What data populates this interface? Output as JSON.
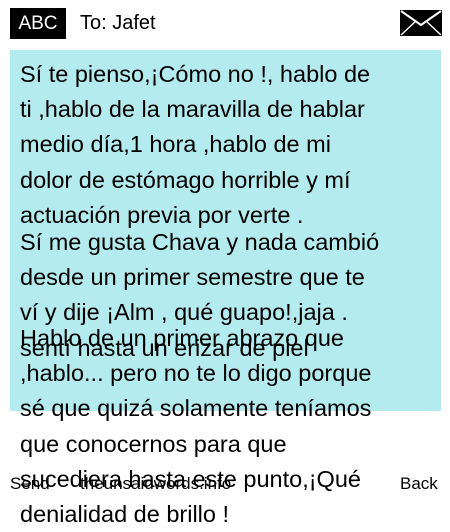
{
  "header": {
    "input_mode": "ABC",
    "to_text": "To: Jafet",
    "envelope_icon": "envelope-icon"
  },
  "message": {
    "paragraphs": [
      "Sí te pienso,¡Cómo no !, hablo de\nti ,hablo de la maravilla de hablar\nmedio día,1 hora ,hablo de mi\ndolor de estómago horrible y mí\nactuación previa por verte .",
      "Sí me gusta Chava y nada cambió\ndesde un primer semestre que te\nví y dije ¡Alm , qué guapo!,jaja .\nsentí hasta un erizar de piel",
      "Hablo de un primer abrazo que\n,hablo... pero no te lo digo porque\nsé que quizá solamente teníamos\nque conocernos para que\nsucediera hasta este punto,¡Qué\ndenialidad de brillo !"
    ],
    "background_color": "#b3ebef"
  },
  "footer": {
    "send_label": "Send",
    "watermark": "theunsaidwords.info",
    "back_label": "Back"
  }
}
